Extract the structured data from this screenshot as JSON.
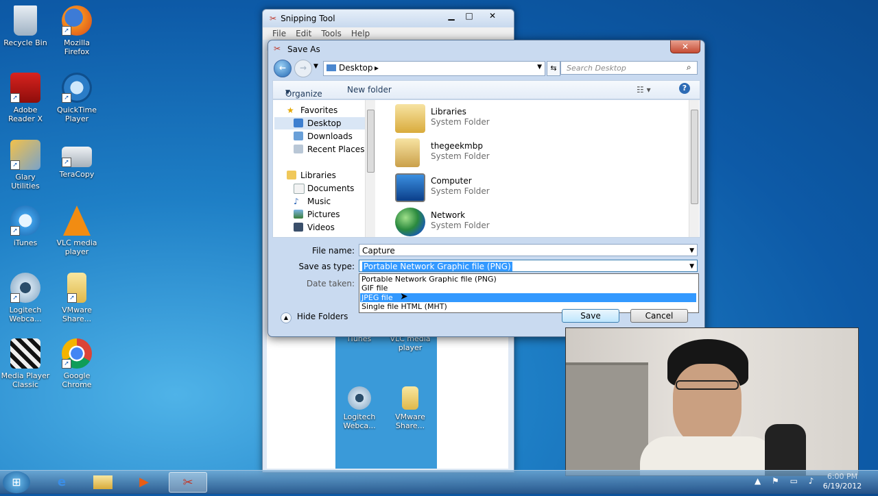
{
  "desktop": {
    "icons": [
      {
        "label": "Recycle Bin"
      },
      {
        "label": "Mozilla Firefox"
      },
      {
        "label": "Adobe Reader X"
      },
      {
        "label": "QuickTime Player"
      },
      {
        "label": "Glary Utilities"
      },
      {
        "label": "TeraCopy"
      },
      {
        "label": "iTunes"
      },
      {
        "label": "VLC media player"
      },
      {
        "label": "Logitech Webca..."
      },
      {
        "label": "VMware Share..."
      },
      {
        "label": "Media Player Classic"
      },
      {
        "label": "Google Chrome"
      }
    ]
  },
  "snipping_tool": {
    "title": "Snipping Tool",
    "menu": [
      "File",
      "Edit",
      "Tools",
      "Help"
    ],
    "capture_icons": [
      {
        "label": "iTunes"
      },
      {
        "label": "VLC media player"
      },
      {
        "label": "Logitech Webca..."
      },
      {
        "label": "VMware Share..."
      }
    ]
  },
  "save_as": {
    "title": "Save As",
    "close_label": "✕",
    "address": {
      "path": "Desktop",
      "search_placeholder": "Search Desktop"
    },
    "toolbar": {
      "organize": "Organize",
      "new_folder": "New folder"
    },
    "nav": {
      "favorites": "Favorites",
      "favorites_items": [
        "Desktop",
        "Downloads",
        "Recent Places"
      ],
      "libraries": "Libraries",
      "libraries_items": [
        "Documents",
        "Music",
        "Pictures",
        "Videos"
      ]
    },
    "files": [
      {
        "name": "Libraries",
        "type": "System Folder"
      },
      {
        "name": "thegeekmbp",
        "type": "System Folder"
      },
      {
        "name": "Computer",
        "type": "System Folder"
      },
      {
        "name": "Network",
        "type": "System Folder"
      }
    ],
    "filename_label": "File name:",
    "filename_value": "Capture",
    "savetype_label": "Save as type:",
    "savetype_value": "Portable Network Graphic file (PNG)",
    "date_label": "Date taken:",
    "dropdown_options": [
      "Portable Network Graphic file (PNG)",
      "GIF file",
      "JPEG file",
      "Single file HTML (MHT)"
    ],
    "selected_option": "JPEG file",
    "hide_folders": "Hide Folders",
    "save_button": "Save",
    "cancel_button": "Cancel"
  },
  "taskbar": {
    "clock_time": "6:00 PM",
    "clock_date": "6/19/2012"
  },
  "colors": {
    "selection": "#3399ff",
    "desktop_blue": "#1e7fc6"
  }
}
